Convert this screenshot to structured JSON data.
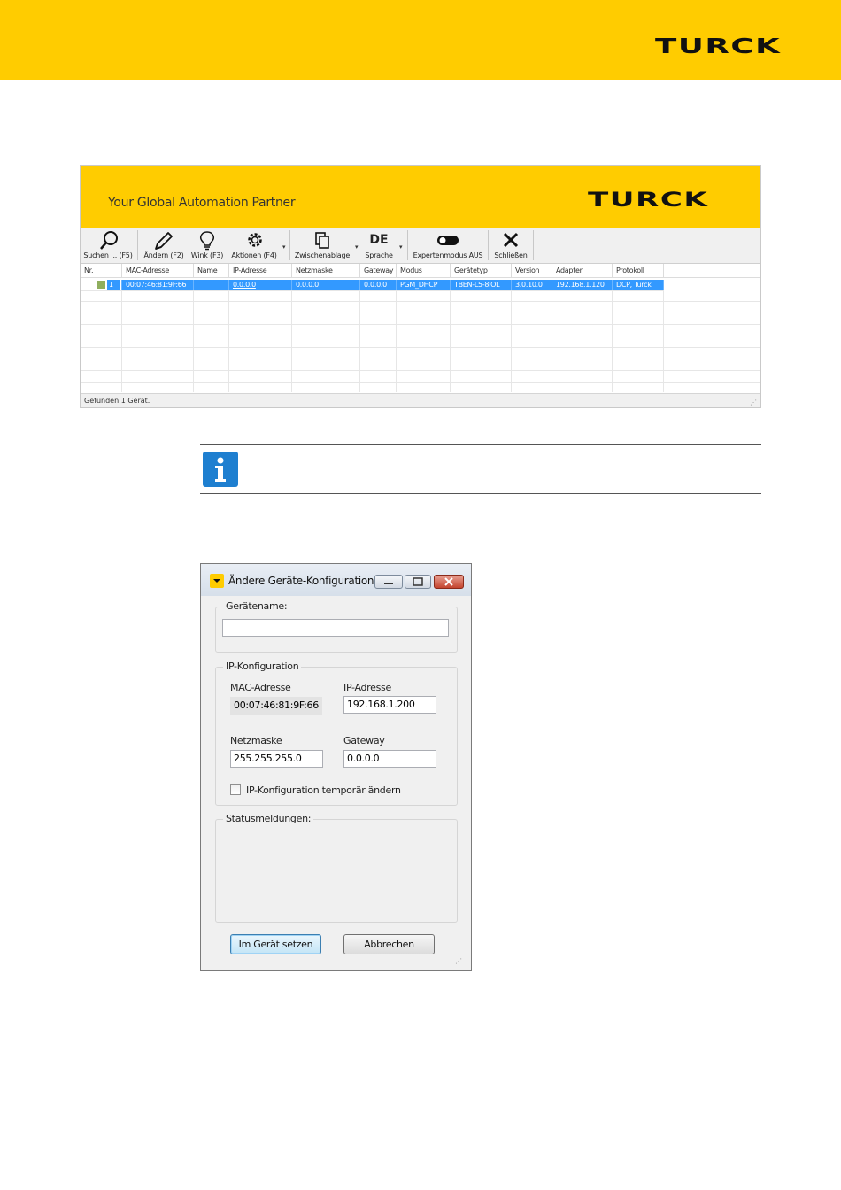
{
  "page": {
    "brand": "TURCK"
  },
  "tool": {
    "brand": "TURCK",
    "tagline": "Your Global Automation Partner",
    "toolbar": {
      "search": "Suchen ... (F5)",
      "change": "Ändern (F2)",
      "wink": "Wink (F3)",
      "actions": "Aktionen (F4)",
      "clipboard": "Zwischenablage",
      "language_code": "DE",
      "language": "Sprache",
      "expert": "Expertenmodus AUS",
      "close": "Schließen"
    },
    "columns": [
      "Nr.",
      "MAC-Adresse",
      "Name",
      "IP-Adresse",
      "Netzmaske",
      "Gateway",
      "Modus",
      "Gerätetyp",
      "Version",
      "Adapter",
      "Protokoll"
    ],
    "rows": [
      {
        "nr": "1",
        "mac": "00:07:46:81:9F:66",
        "name": "",
        "ip": "0.0.0.0",
        "netmask": "0.0.0.0",
        "gateway": "0.0.0.0",
        "mode": "PGM_DHCP",
        "device_type": "TBEN-L5-8IOL",
        "version": "3.0.10.0",
        "adapter": "192.168.1.120",
        "protocol": "DCP, Turck"
      }
    ],
    "status": "Gefunden 1 Gerät."
  },
  "dialog": {
    "title": "Ändere Geräte-Konfiguration",
    "device_name_group": "Gerätename:",
    "device_name_value": "",
    "ip_group": "IP-Konfiguration",
    "mac_label": "MAC-Adresse",
    "mac_value": "00:07:46:81:9F:66",
    "ip_label": "IP-Adresse",
    "ip_value": "192.168.1.200",
    "netmask_label": "Netzmaske",
    "netmask_value": "255.255.255.0",
    "gateway_label": "Gateway",
    "gateway_value": "0.0.0.0",
    "temp_checkbox": "IP-Konfiguration temporär ändern",
    "status_group": "Statusmeldungen:",
    "set_button": "Im Gerät setzen",
    "cancel_button": "Abbrechen"
  },
  "colors": {
    "brand_yellow": "#FFCC00",
    "selection_blue": "#3399FF",
    "info_blue": "#1E7FD0"
  }
}
